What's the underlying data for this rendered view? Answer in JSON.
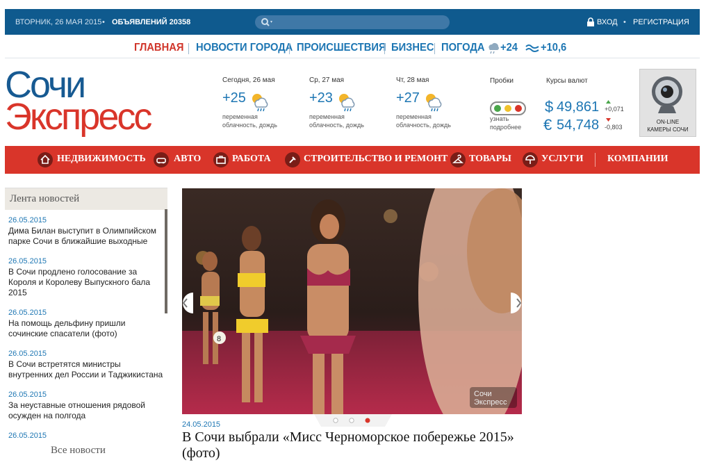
{
  "topbar": {
    "date": "ВТОРНИК, 26 МАЯ 2015",
    "ads": "ОБЪЯВЛЕНИЙ 20358",
    "login": "ВХОД",
    "register": "РЕГИСТРАЦИЯ"
  },
  "nav": {
    "home": "ГЛАВНАЯ",
    "city": "НОВОСТИ ГОРОДА",
    "incidents": "ПРОИСШЕСТВИЯ",
    "business": "БИЗНЕС",
    "weather": "ПОГОДА",
    "air_temp": "+24",
    "water_temp": "+10,6"
  },
  "logo": {
    "line1": "Сочи",
    "line2": "Экспресс"
  },
  "weather": [
    {
      "day": "Сегодня, 26 мая",
      "temp": "+25",
      "desc1": "переменная",
      "desc2": "облачность, дождь"
    },
    {
      "day": "Ср, 27 мая",
      "temp": "+23",
      "desc1": "переменная",
      "desc2": "облачность, дождь"
    },
    {
      "day": "Чт, 28 мая",
      "temp": "+27",
      "desc1": "переменная",
      "desc2": "облачность, дождь"
    }
  ],
  "traffic": {
    "label": "Пробки",
    "link1": "узнать",
    "link2": "подробнее"
  },
  "currency": {
    "label": "Курсы валют",
    "usd_symbol": "$",
    "usd": "49,861",
    "usd_change": "+0,071",
    "eur_symbol": "€",
    "eur": "54,748",
    "eur_change": "-0,803"
  },
  "camera": {
    "line1": "ON-LINE",
    "line2": "КАМЕРЫ СОЧИ"
  },
  "categories": [
    "НЕДВИЖИМОСТЬ",
    "АВТО",
    "РАБОТА",
    "СТРОИТЕЛЬСТВО И РЕМОНТ",
    "ТОВАРЫ",
    "УСЛУГИ",
    "КОМПАНИИ"
  ],
  "feed": {
    "title": "Лента новостей",
    "items": [
      {
        "date": "26.05.2015",
        "text": "Дима Билан выступит в Олимпийском парке Сочи в ближайшие выходные"
      },
      {
        "date": "26.05.2015",
        "text": "В Сочи продлено голосование за Короля и Королеву Выпускного бала 2015"
      },
      {
        "date": "26.05.2015",
        "text": "На помощь дельфину пришли сочинские спасатели (фото)"
      },
      {
        "date": "26.05.2015",
        "text": "В Сочи встретятся министры внутренних дел России и Таджикистана"
      },
      {
        "date": "26.05.2015",
        "text": "За неуставные отношения рядовой осужден на полгода"
      },
      {
        "date": "26.05.2015",
        "text": ""
      }
    ],
    "all": "Все новости"
  },
  "slider": {
    "date": "24.05.2015",
    "title": "В Сочи выбрали «Мисс Черноморское побережье 2015» (фото)",
    "watermark1": "Сочи",
    "watermark2": "Экспресс",
    "badge": "8",
    "active_dot": 3,
    "dot_count": 3
  }
}
